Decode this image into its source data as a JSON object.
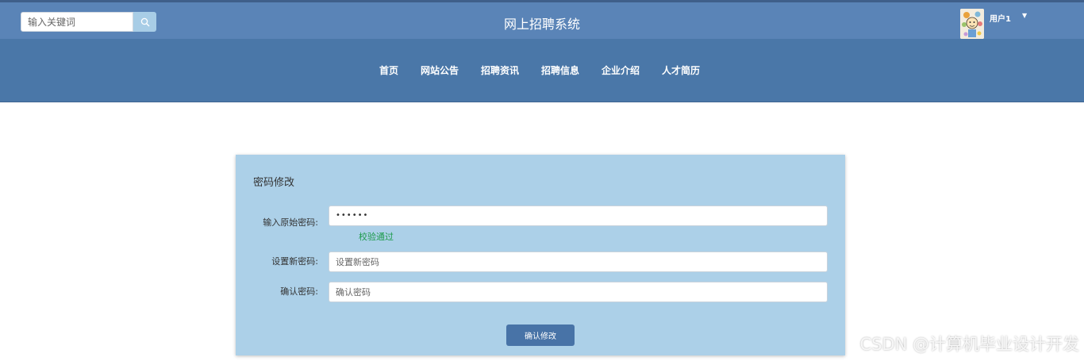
{
  "header": {
    "search_placeholder": "输入关键词",
    "site_title": "网上招聘系统",
    "user_name": "用户1"
  },
  "nav": {
    "items": [
      "首页",
      "网站公告",
      "招聘资讯",
      "招聘信息",
      "企业介绍",
      "人才简历"
    ]
  },
  "form": {
    "title": "密码修改",
    "old_password_label": "输入原始密码:",
    "old_password_value": "••••••",
    "validation_hint": "校验通过",
    "new_password_label": "设置新密码:",
    "new_password_placeholder": "设置新密码",
    "confirm_label": "确认密码:",
    "confirm_placeholder": "确认密码",
    "submit_label": "确认修改"
  },
  "watermark": "CSDN @计算机毕业设计开发",
  "colors": {
    "topbar": "#5a84b7",
    "navbar": "#4a77a8",
    "panel": "#acd0e8",
    "button": "#4873a7",
    "success": "#1d9b4b"
  }
}
